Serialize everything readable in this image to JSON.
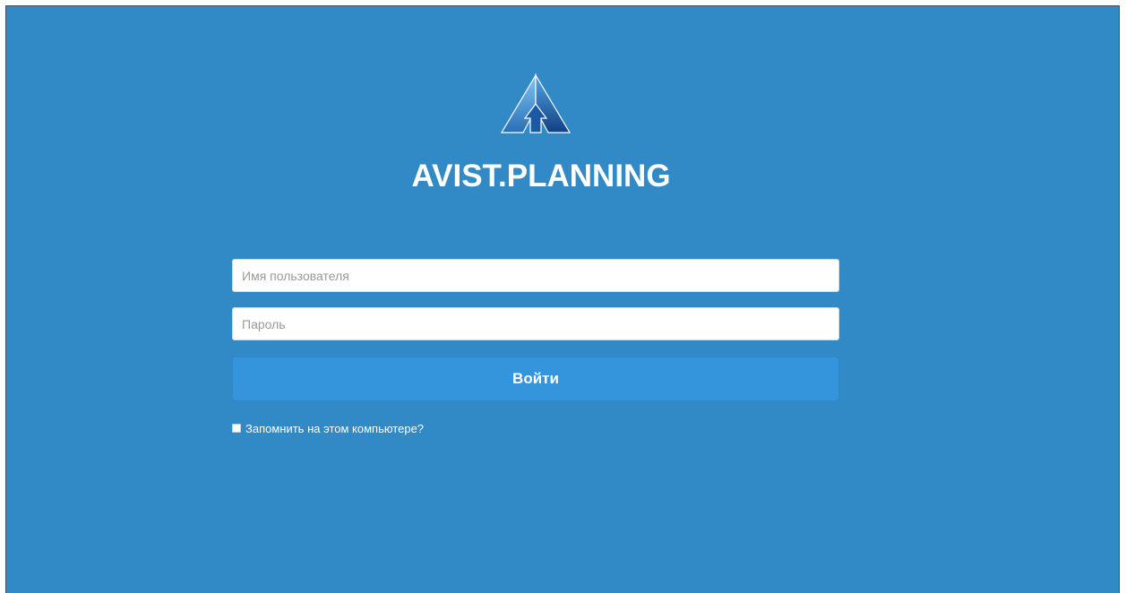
{
  "app": {
    "brand_name": "AVIST.PLANNING",
    "logo_icon": "triangle-arrow-logo-icon"
  },
  "login_form": {
    "username_placeholder": "Имя пользователя",
    "username_value": "",
    "password_placeholder": "Пароль",
    "password_value": "",
    "submit_label": "Войти",
    "remember_label": "Запомнить на этом компьютере?",
    "remember_checked": false
  },
  "colors": {
    "background": "#318ac6",
    "button": "#3595dc",
    "text": "#ffffff"
  }
}
